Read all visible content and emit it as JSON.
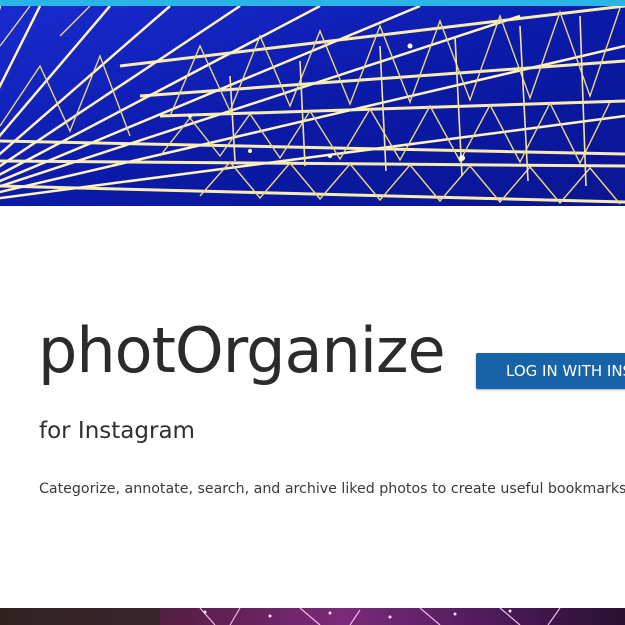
{
  "app": {
    "title": "photOrganize",
    "subtitle": "for Instagram",
    "description": "Categorize, annotate, search, and archive liked photos to create useful bookmarks and r",
    "login_label": "LOG IN WITH INSTAGRAM"
  },
  "colors": {
    "top_stripe": "#29b6e6",
    "sky_blue": "#0f1fb0",
    "button_blue": "#1763a8",
    "title_text": "#2b2b2b"
  },
  "images": {
    "hero": "ferris-wheel-photo",
    "footer": "night-lights-photo"
  }
}
